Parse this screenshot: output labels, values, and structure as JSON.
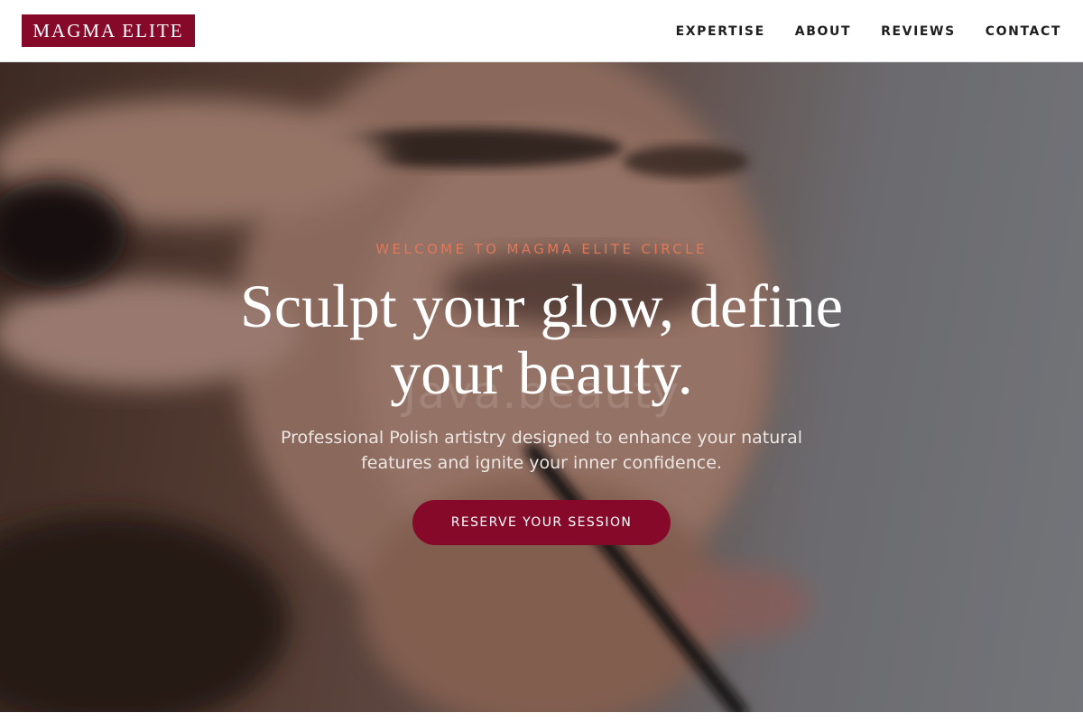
{
  "nav": {
    "logo": "MAGMA ELITE",
    "links": [
      "EXPERTISE",
      "ABOUT",
      "REVIEWS",
      "CONTACT"
    ]
  },
  "hero": {
    "background_image": "blurred-makeup-application-photo",
    "eyebrow": "WELCOME TO MAGMA ELITE CIRCLE",
    "headline_line1": "Sculpt your glow, define",
    "headline_line2": "your beauty.",
    "watermark": "Java.beauty",
    "subtext_line1": "Professional Polish artistry designed to enhance your natural",
    "subtext_line2": "features and ignite your inner confidence.",
    "cta_label": "RESERVE YOUR SESSION"
  },
  "colors": {
    "brand": "#86092a",
    "eyebrow": "#e0785a",
    "text_on_hero": "#ffffff"
  }
}
